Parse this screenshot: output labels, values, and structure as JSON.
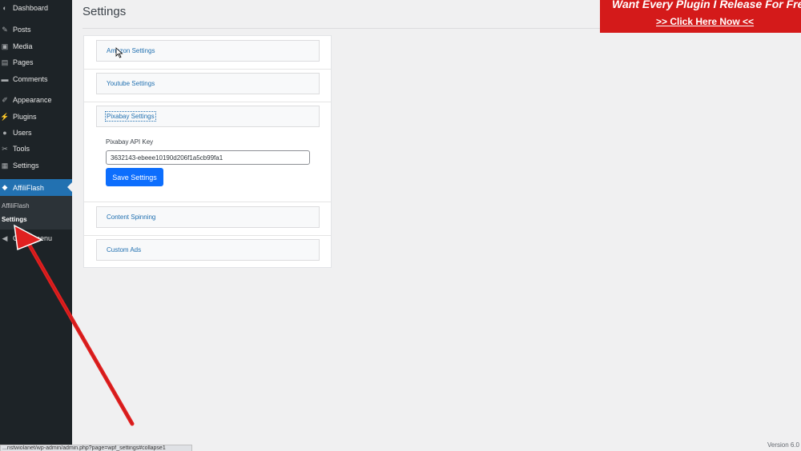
{
  "sidebar": {
    "items": [
      {
        "id": "dashboard",
        "label": "Dashboard",
        "icon": "gauge-icon",
        "glyph": "◐"
      },
      {
        "id": "posts",
        "label": "Posts",
        "icon": "pin-icon",
        "glyph": "✎"
      },
      {
        "id": "media",
        "label": "Media",
        "icon": "media-icon",
        "glyph": "▣"
      },
      {
        "id": "pages",
        "label": "Pages",
        "icon": "pages-icon",
        "glyph": "▤"
      },
      {
        "id": "comments",
        "label": "Comments",
        "icon": "comment-icon",
        "glyph": "▬"
      },
      {
        "id": "appearance",
        "label": "Appearance",
        "icon": "brush-icon",
        "glyph": "✐"
      },
      {
        "id": "plugins",
        "label": "Plugins",
        "icon": "plug-icon",
        "glyph": "⚡"
      },
      {
        "id": "users",
        "label": "Users",
        "icon": "user-icon",
        "glyph": "●"
      },
      {
        "id": "tools",
        "label": "Tools",
        "icon": "wrench-icon",
        "glyph": "✂"
      },
      {
        "id": "settings",
        "label": "Settings",
        "icon": "settings-icon",
        "glyph": "▦"
      },
      {
        "id": "affiliflash",
        "label": "AffiliFlash",
        "icon": "plugin-icon",
        "glyph": "◆"
      }
    ],
    "submenu": {
      "items": [
        "AffiliFlash",
        "Settings"
      ]
    },
    "collapse": {
      "label": "Collapse menu",
      "visible_label": "C     e menu",
      "icon": "collapse-icon",
      "glyph": "◀"
    }
  },
  "header": {
    "title": "Settings"
  },
  "banner": {
    "headline": "Want Every Plugin I Release For Free",
    "cta": ">> Click Here Now <<"
  },
  "panel": {
    "sections": [
      {
        "label": "Amazon Settings",
        "expanded": false
      },
      {
        "label": "Youtube Settings",
        "expanded": false
      },
      {
        "label": "Pixabay Settings",
        "expanded": true
      },
      {
        "label": "Content Spinning",
        "expanded": false
      },
      {
        "label": "Custom Ads",
        "expanded": false
      }
    ],
    "pixabay": {
      "api_key_label": "Pixabay API Key",
      "api_key_value": "3632143-ebeee10190d206f1a5cb99fa1",
      "save_label": "Save Settings"
    }
  },
  "footer": {
    "status_url": "...nstwiolanet/wp-admin/admin.php?page=wpf_settings#collapse1",
    "version": "Version 6.0"
  },
  "colors": {
    "sidebar": "#1d2327",
    "active": "#2271b1",
    "link": "#2271b1",
    "button": "#0d6efd",
    "banner": "#d41a1a",
    "arrow": "#e02020"
  }
}
